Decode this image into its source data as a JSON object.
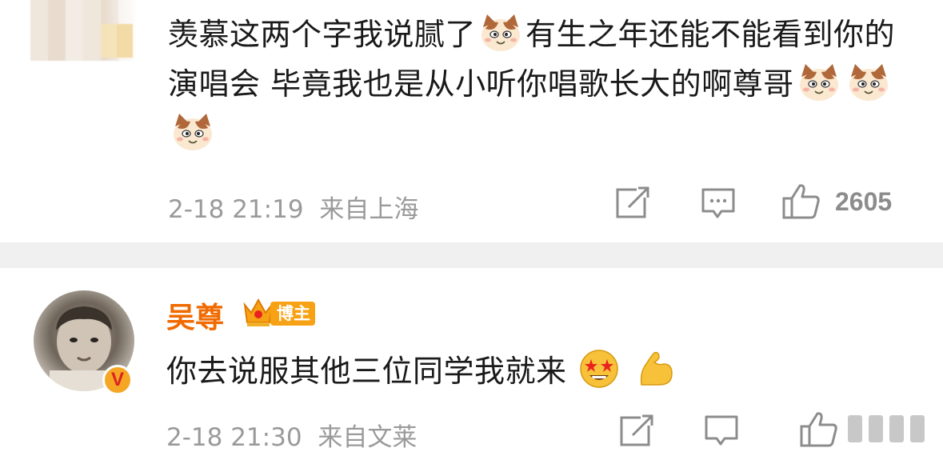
{
  "comments": [
    {
      "text_part1": "羡慕这两个字我说腻了",
      "text_part2": "有生之年还能不能看到你的演唱会 毕竟我也是从小听你唱歌长大的啊尊哥",
      "emoji_inline": "cat-face-icon",
      "emoji_trailing": [
        "cat-face-icon",
        "cat-face-icon",
        "cat-face-icon"
      ],
      "timestamp": "2-18 21:19",
      "location": "来自上海",
      "like_count": "2605"
    },
    {
      "author": "吴尊",
      "badge": "博主",
      "text": "你去说服其他三位同学我就来",
      "emojis": [
        "star-struck-face-icon",
        "flexed-biceps-icon"
      ],
      "timestamp": "2-18 21:30",
      "location": "来自文莱"
    }
  ],
  "colors": {
    "author_name": "#f06a00",
    "badge_bg": "#f7a215",
    "meta_gray": "#9a9a9a",
    "divider": "#f0f0f0"
  }
}
